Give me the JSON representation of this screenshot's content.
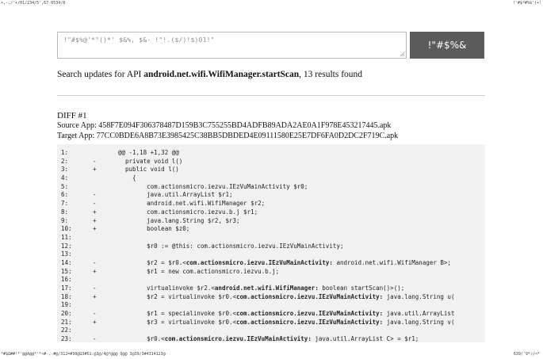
{
  "header": {
    "top_left": "+,-./'+/01/234/5',67-0534/8",
    "top_right": "!'#$*#%&'(+!"
  },
  "search": {
    "value": "!\"#$%@'*\"()*' $&%, $&- !\"!.($/)!$)01!\"",
    "button_label": "!\"#$%&"
  },
  "summary": {
    "prefix": "Search updates for API ",
    "api": "android.net.wifi.WifiManager.startScan",
    "suffix": ", 13 results found"
  },
  "diff": {
    "title": "DIFF #1",
    "source": "Source App: 458F7E094F306378487D159B3C755255BD4ADFB89ADA2AE0A1F978E453217445.apk",
    "target": "Target App: 77CC0BDE6A8B73E3985425C38BB5DBDED4E09111580E25E7DF6FA0D2DC2F719C.apk",
    "lines": [
      {
        "n": "1:",
        "m": "",
        "pre": "@@ -1,18 +1,32 @@",
        "b": "",
        "post": ""
      },
      {
        "n": "2:",
        "m": "-",
        "pre": "  private void l()",
        "b": "",
        "post": ""
      },
      {
        "n": "3:",
        "m": "+",
        "pre": "  public void l()",
        "b": "",
        "post": ""
      },
      {
        "n": "4:",
        "m": "",
        "pre": "    {",
        "b": "",
        "post": ""
      },
      {
        "n": "5:",
        "m": "",
        "pre": "        com.actionsmicro.iezvu.IEzVuMainActivity $r0;",
        "b": "",
        "post": ""
      },
      {
        "n": "6:",
        "m": "-",
        "pre": "        java.util.ArrayList $r1;",
        "b": "",
        "post": ""
      },
      {
        "n": "7:",
        "m": "-",
        "pre": "        android.net.wifi.WifiManager $r2;",
        "b": "",
        "post": ""
      },
      {
        "n": "8:",
        "m": "+",
        "pre": "        com.actionsmicro.iezvu.b.j $r1;",
        "b": "",
        "post": ""
      },
      {
        "n": "9:",
        "m": "+",
        "pre": "        java.lang.String $r2, $r3;",
        "b": "",
        "post": ""
      },
      {
        "n": "10:",
        "m": "+",
        "pre": "        boolean $z0;",
        "b": "",
        "post": ""
      },
      {
        "n": "11:",
        "m": "",
        "pre": "",
        "b": "",
        "post": ""
      },
      {
        "n": "12:",
        "m": "",
        "pre": "        $r0 := @this: com.actionsmicro.iezvu.IEzVuMainActivity;",
        "b": "",
        "post": ""
      },
      {
        "n": "13:",
        "m": "",
        "pre": "",
        "b": "",
        "post": ""
      },
      {
        "n": "14:",
        "m": "-",
        "pre": "        $r2 = $r0.<",
        "b": "com.actionsmicro.iezvu.IEzVuMainActivity:",
        "post": " android.net.wifi.WifiManager B>;"
      },
      {
        "n": "15:",
        "m": "+",
        "pre": "        $r1 = new com.actionsmicro.iezvu.b.j;",
        "b": "",
        "post": ""
      },
      {
        "n": "16:",
        "m": "",
        "pre": "",
        "b": "",
        "post": ""
      },
      {
        "n": "17:",
        "m": "-",
        "pre": "        virtualinvoke $r2.<",
        "b": "android.net.wifi.WifiManager:",
        "post": " boolean startScan()>();"
      },
      {
        "n": "18:",
        "m": "+",
        "pre": "        $r2 = virtualinvoke $r0.<",
        "b": "com.actionsmicro.iezvu.IEzVuMainActivity:",
        "post": " java.lang.String u("
      },
      {
        "n": "19:",
        "m": "",
        "pre": "",
        "b": "",
        "post": ""
      },
      {
        "n": "20:",
        "m": "-",
        "pre": "        $r1 = specialinvoke $r0.<",
        "b": "com.actionsmicro.iezvu.IEzVuMainActivity:",
        "post": " java.util.ArrayList"
      },
      {
        "n": "21:",
        "m": "+",
        "pre": "        $r3 = virtualinvoke $r0.<",
        "b": "com.actionsmicro.iezvu.IEzVuMainActivity:",
        "post": " java.lang.String v("
      },
      {
        "n": "22:",
        "m": "",
        "pre": "",
        "b": "",
        "post": ""
      },
      {
        "n": "23:",
        "m": "-",
        "pre": "        $r0.<",
        "b": "com.actionsmicro.iezvu.IEzVuMainActivity:",
        "post": " java.util.ArrayList C> = $r1;"
      }
    ]
  },
  "footer": {
    "left": "*#$Ω##!*'@@A@@*'*<#-,-#@/312=#30@Ω3#51:@3@/4@*@@@ Q@@ 3@39/3#4314123@",
    "right": "639/'9*;/<*"
  }
}
